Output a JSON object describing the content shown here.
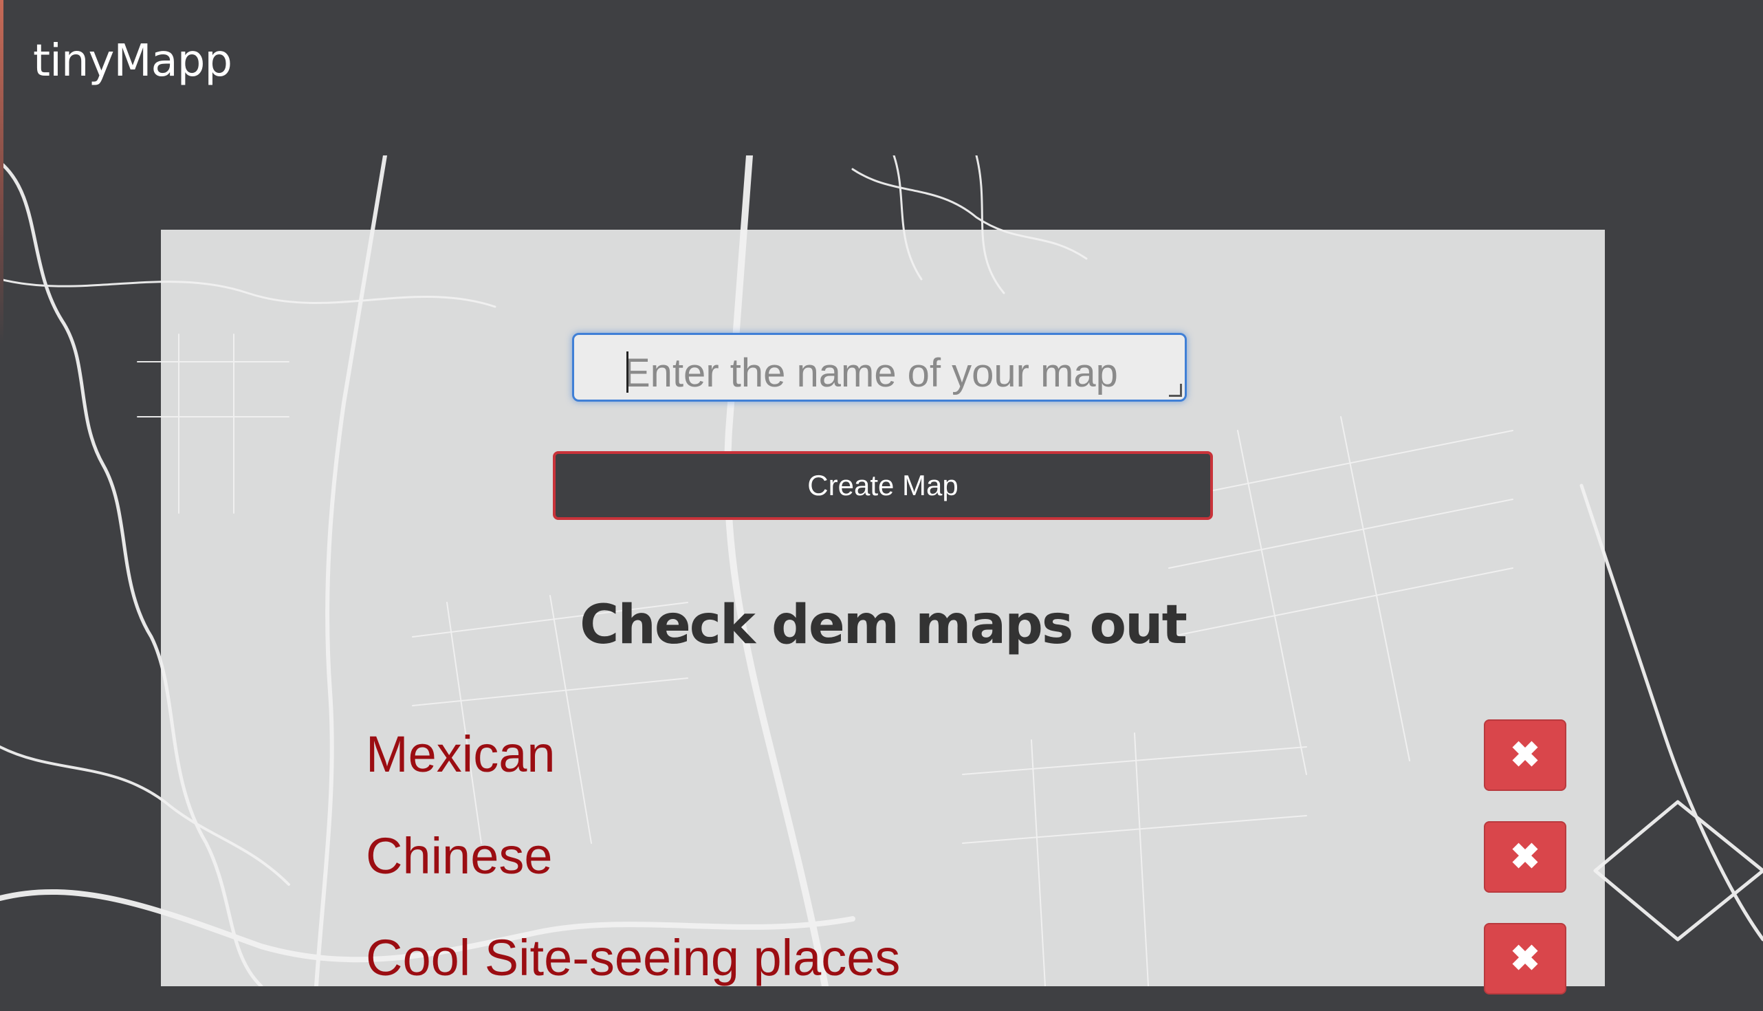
{
  "navbar": {
    "brand": "tinyMapp"
  },
  "form": {
    "placeholder": "Enter the name of your map",
    "create_label": "Create Map"
  },
  "section": {
    "title": "Check dem maps out"
  },
  "maps": [
    {
      "name": "Mexican",
      "delete_icon": "✖"
    },
    {
      "name": "Chinese",
      "delete_icon": "✖"
    },
    {
      "name": "Cool Site-seeing places",
      "delete_icon": "✖"
    }
  ],
  "colors": {
    "background": "#3f4043",
    "panel": "#f0f0f0",
    "map_link": "#9b0d12",
    "delete_button": "#d9464b",
    "create_button_border": "#c8333a",
    "input_focus": "#3f7fd6"
  }
}
